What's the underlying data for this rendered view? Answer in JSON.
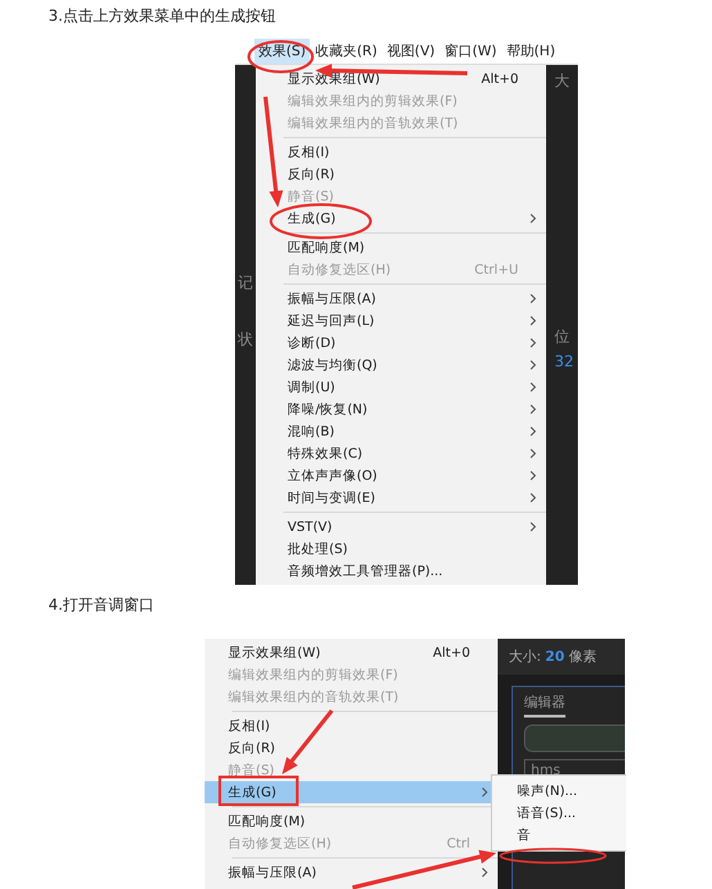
{
  "steps": [
    {
      "title": "3.点击上方效果菜单中的生成按钮",
      "screenshot": {
        "menubar": [
          {
            "label": "效果(S)",
            "selected": true
          },
          {
            "label": "收藏夹(R)",
            "selected": false
          },
          {
            "label": "视图(V)",
            "selected": false
          },
          {
            "label": "窗口(W)",
            "selected": false
          },
          {
            "label": "帮助(H)",
            "selected": false
          }
        ],
        "left_fragments": [
          "记",
          "状"
        ],
        "right_fragments": [
          "大",
          "位",
          "32"
        ],
        "menu": [
          {
            "kind": "item",
            "label": "显示效果组(W)",
            "shortcut": "Alt+0",
            "disabled": false,
            "submenu": false,
            "selected": false
          },
          {
            "kind": "item",
            "label": "编辑效果组内的剪辑效果(F)",
            "disabled": true,
            "submenu": false,
            "selected": false
          },
          {
            "kind": "item",
            "label": "编辑效果组内的音轨效果(T)",
            "disabled": true,
            "submenu": false,
            "selected": false
          },
          {
            "kind": "separator"
          },
          {
            "kind": "item",
            "label": "反相(I)",
            "disabled": false,
            "submenu": false,
            "selected": false
          },
          {
            "kind": "item",
            "label": "反向(R)",
            "disabled": false,
            "submenu": false,
            "selected": false
          },
          {
            "kind": "item",
            "label": "静音(S)",
            "disabled": true,
            "submenu": false,
            "selected": false
          },
          {
            "kind": "item",
            "label": "生成(G)",
            "disabled": false,
            "submenu": true,
            "selected": false
          },
          {
            "kind": "separator"
          },
          {
            "kind": "item",
            "label": "匹配响度(M)",
            "disabled": false,
            "submenu": false,
            "selected": false
          },
          {
            "kind": "item",
            "label": "自动修复选区(H)",
            "shortcut": "Ctrl+U",
            "disabled": true,
            "submenu": false,
            "selected": false
          },
          {
            "kind": "separator"
          },
          {
            "kind": "item",
            "label": "振幅与压限(A)",
            "disabled": false,
            "submenu": true,
            "selected": false
          },
          {
            "kind": "item",
            "label": "延迟与回声(L)",
            "disabled": false,
            "submenu": true,
            "selected": false
          },
          {
            "kind": "item",
            "label": "诊断(D)",
            "disabled": false,
            "submenu": true,
            "selected": false
          },
          {
            "kind": "item",
            "label": "滤波与均衡(Q)",
            "disabled": false,
            "submenu": true,
            "selected": false
          },
          {
            "kind": "item",
            "label": "调制(U)",
            "disabled": false,
            "submenu": true,
            "selected": false
          },
          {
            "kind": "item",
            "label": "降噪/恢复(N)",
            "disabled": false,
            "submenu": true,
            "selected": false
          },
          {
            "kind": "item",
            "label": "混响(B)",
            "disabled": false,
            "submenu": true,
            "selected": false
          },
          {
            "kind": "item",
            "label": "特殊效果(C)",
            "disabled": false,
            "submenu": true,
            "selected": false
          },
          {
            "kind": "item",
            "label": "立体声声像(O)",
            "disabled": false,
            "submenu": true,
            "selected": false
          },
          {
            "kind": "item",
            "label": "时间与变调(E)",
            "disabled": false,
            "submenu": true,
            "selected": false
          },
          {
            "kind": "separator"
          },
          {
            "kind": "item",
            "label": "VST(V)",
            "disabled": false,
            "submenu": true,
            "selected": false
          },
          {
            "kind": "item",
            "label": "批处理(S)",
            "disabled": false,
            "submenu": false,
            "selected": false
          },
          {
            "kind": "item",
            "label": "音频增效工具管理器(P)...",
            "disabled": false,
            "submenu": false,
            "selected": false
          }
        ]
      }
    },
    {
      "title": "4.打开音调窗口",
      "screenshot": {
        "panel": {
          "size_label": "大小:",
          "size_value": "20",
          "size_unit": "像素",
          "tab": "编辑器",
          "time": "hms"
        },
        "menu": [
          {
            "kind": "item",
            "label": "显示效果组(W)",
            "shortcut": "Alt+0",
            "disabled": false,
            "submenu": false,
            "selected": false
          },
          {
            "kind": "item",
            "label": "编辑效果组内的剪辑效果(F)",
            "disabled": true,
            "submenu": false,
            "selected": false
          },
          {
            "kind": "item",
            "label": "编辑效果组内的音轨效果(T)",
            "disabled": true,
            "submenu": false,
            "selected": false
          },
          {
            "kind": "separator"
          },
          {
            "kind": "item",
            "label": "反相(I)",
            "disabled": false,
            "submenu": false,
            "selected": false
          },
          {
            "kind": "item",
            "label": "反向(R)",
            "disabled": false,
            "submenu": false,
            "selected": false
          },
          {
            "kind": "item",
            "label": "静音(S)",
            "disabled": true,
            "submenu": false,
            "selected": false
          },
          {
            "kind": "item",
            "label": "生成(G)",
            "disabled": false,
            "submenu": true,
            "selected": true
          },
          {
            "kind": "separator"
          },
          {
            "kind": "item",
            "label": "匹配响度(M)",
            "disabled": false,
            "submenu": false,
            "selected": false
          },
          {
            "kind": "item",
            "label": "自动修复选区(H)",
            "shortcut": "Ctrl",
            "disabled": true,
            "submenu": false,
            "selected": false
          },
          {
            "kind": "separator"
          },
          {
            "kind": "item",
            "label": "振幅与压限(A)",
            "disabled": false,
            "submenu": true,
            "selected": false
          }
        ],
        "submenu": [
          "噪声(N)...",
          "语音(S)...",
          "音"
        ]
      }
    }
  ]
}
